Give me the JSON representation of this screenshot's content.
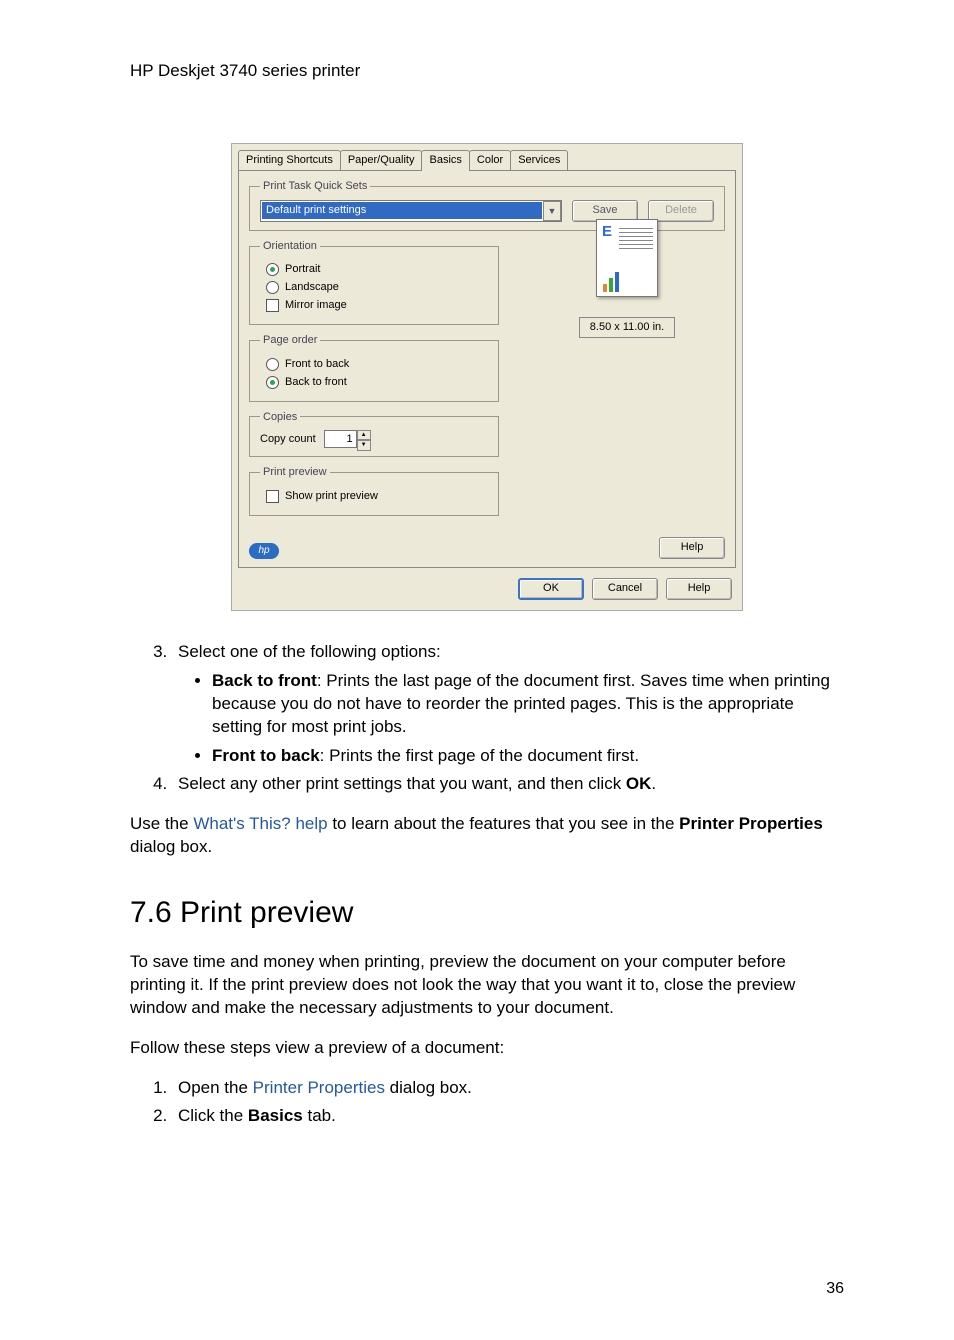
{
  "doc": {
    "header": "HP Deskjet 3740 series printer",
    "page_number": "36"
  },
  "dialog": {
    "tabs": {
      "printing_shortcuts": "Printing Shortcuts",
      "paper_quality": "Paper/Quality",
      "basics": "Basics",
      "color": "Color",
      "services": "Services"
    },
    "print_task_quick_sets": {
      "legend": "Print Task Quick Sets",
      "selected": "Default print settings",
      "save": "Save",
      "delete": "Delete"
    },
    "orientation": {
      "legend": "Orientation",
      "portrait": "Portrait",
      "landscape": "Landscape",
      "mirror": "Mirror image"
    },
    "page_order": {
      "legend": "Page order",
      "front_to_back": "Front to back",
      "back_to_front": "Back to front"
    },
    "copies": {
      "legend": "Copies",
      "label": "Copy count",
      "value": "1"
    },
    "print_preview_grp": {
      "legend": "Print preview",
      "show": "Show print preview"
    },
    "paper_size": "8.50 x 11.00 in.",
    "hp_logo": "hp",
    "buttons": {
      "help_inner": "Help",
      "ok": "OK",
      "cancel": "Cancel",
      "help_outer": "Help"
    }
  },
  "body": {
    "step3_intro": "Select one of the following options:",
    "b2f_label": "Back to front",
    "b2f_desc": ": Prints the last page of the document first. Saves time when printing because you do not have to reorder the printed pages. This is the appropriate setting for most print jobs.",
    "f2b_label": "Front to back",
    "f2b_desc": ": Prints the first page of the document first.",
    "step4_a": "Select any other print settings that you want, and then click ",
    "step4_b": "OK",
    "step4_c": ".",
    "usepara_a": "Use the ",
    "usepara_link": "What's This? help",
    "usepara_b": " to learn about the features that you see in the ",
    "usepara_c": "Printer Properties",
    "usepara_d": " dialog box.",
    "section_heading": "7.6  Print preview",
    "pp_para": "To save time and money when printing, preview the document on your computer before printing it. If the print preview does not look the way that you want it to, close the preview window and make the necessary adjustments to your document.",
    "pp_steps_intro": "Follow these steps view a preview of a document:",
    "pp_step1_a": "Open the ",
    "pp_step1_link": "Printer Properties",
    "pp_step1_b": " dialog box.",
    "pp_step2_a": "Click the ",
    "pp_step2_b": "Basics",
    "pp_step2_c": " tab."
  }
}
